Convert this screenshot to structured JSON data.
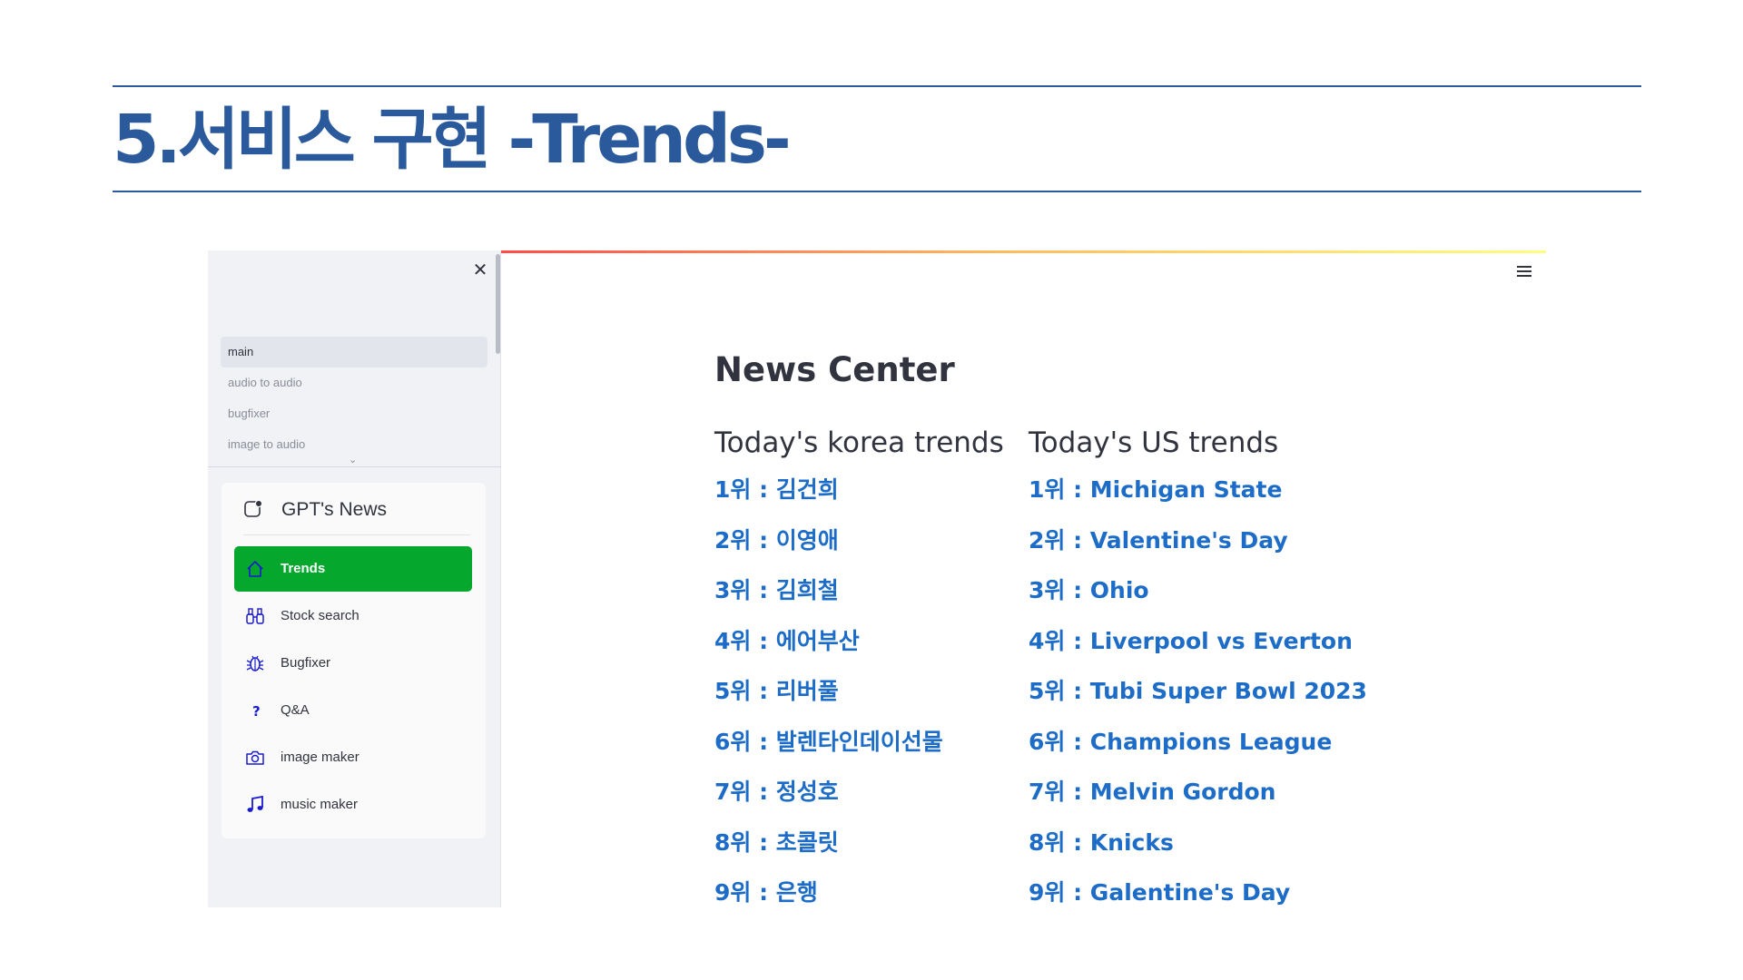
{
  "slide": {
    "title": "5.서비스 구현 -Trends-"
  },
  "sidebar": {
    "pages": [
      {
        "label": "main",
        "active": true
      },
      {
        "label": "audio to audio",
        "active": false
      },
      {
        "label": "bugfixer",
        "active": false
      },
      {
        "label": "image to audio",
        "active": false
      }
    ],
    "menu": {
      "title": "GPT's News",
      "items": [
        {
          "label": "Trends",
          "icon": "house-icon",
          "active": true
        },
        {
          "label": "Stock search",
          "icon": "binoculars-icon",
          "active": false
        },
        {
          "label": "Bugfixer",
          "icon": "bug-icon",
          "active": false
        },
        {
          "label": "Q&A",
          "icon": "question-icon",
          "active": false
        },
        {
          "label": "image maker",
          "icon": "camera-icon",
          "active": false
        },
        {
          "label": "music maker",
          "icon": "music-note-icon",
          "active": false
        }
      ]
    }
  },
  "main": {
    "heading": "News Center",
    "korea": {
      "title": "Today's korea trends",
      "items": [
        "1위 : 김건희",
        "2위 : 이영애",
        "3위 : 김희철",
        "4위 : 에어부산",
        "5위 : 리버풀",
        "6위 : 발렌타인데이선물",
        "7위 : 정성호",
        "8위 : 초콜릿",
        "9위 : 은행"
      ]
    },
    "us": {
      "title": "Today's US trends",
      "items": [
        "1위 : Michigan State",
        "2위 : Valentine's Day",
        "3위 : Ohio",
        "4위 : Liverpool vs Everton",
        "5위 : Tubi Super Bowl 2023",
        "6위 : Champions League",
        "7위 : Melvin Gordon",
        "8위 : Knicks",
        "9위 : Galentine's Day"
      ]
    }
  },
  "colors": {
    "slide_accent": "#2a5a9c",
    "active_menu": "#05a82d",
    "link": "#1c6cc8",
    "menu_icon": "#1a1ad0"
  }
}
